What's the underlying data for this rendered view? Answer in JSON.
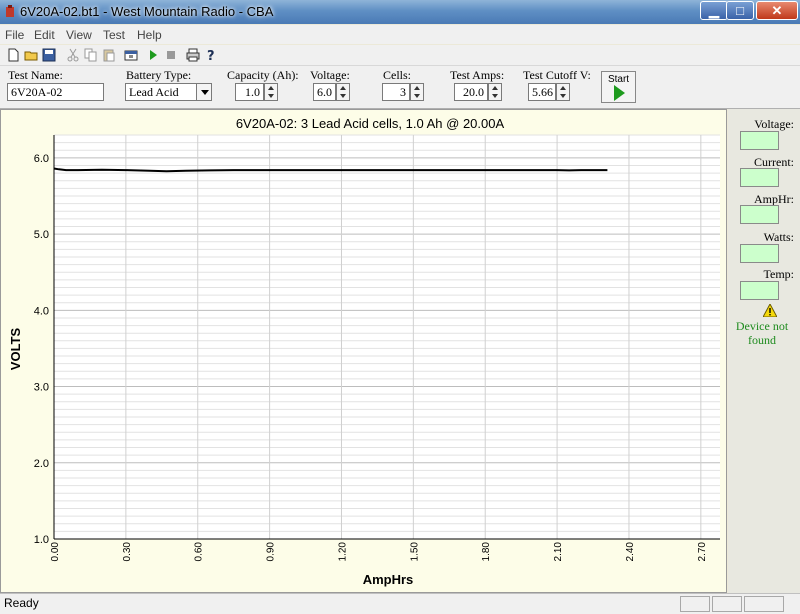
{
  "window": {
    "title": "6V20A-02.bt1 - West Mountain Radio - CBA"
  },
  "menu": [
    "File",
    "Edit",
    "View",
    "Test",
    "Help"
  ],
  "toolbar_icons": [
    "new-file-icon",
    "open-folder-icon",
    "save-icon",
    "cut-icon",
    "copy-icon",
    "paste-icon",
    "settings-icon",
    "run-icon",
    "stop-icon",
    "print-icon",
    "help-icon"
  ],
  "params": {
    "test_name_label": "Test Name:",
    "test_name_value": "6V20A-02",
    "battery_type_label": "Battery Type:",
    "battery_type_value": "Lead Acid",
    "capacity_label": "Capacity (Ah):",
    "capacity_value": "1.0",
    "voltage_label": "Voltage:",
    "voltage_value": "6.0",
    "cells_label": "Cells:",
    "cells_value": "3",
    "test_amps_label": "Test Amps:",
    "test_amps_value": "20.0",
    "cutoff_label": "Test Cutoff V:",
    "cutoff_value": "5.66",
    "start_label": "Start"
  },
  "side": {
    "voltage_label": "Voltage:",
    "current_label": "Current:",
    "amphr_label": "AmpHr:",
    "watts_label": "Watts:",
    "temp_label": "Temp:",
    "device_status": "Device not found",
    "readout_color": "#ccffcc"
  },
  "status": {
    "text": "Ready"
  },
  "colors": {
    "plot_background": "#fdfde8",
    "line": "#000000",
    "status_green": "#1e8b1e"
  },
  "chart_data": {
    "type": "line",
    "title": "6V20A-02: 3 Lead Acid cells, 1.0 Ah @ 20.00A",
    "xlabel": "AmpHrs",
    "ylabel": "VOLTS",
    "xlim": [
      0,
      2.78
    ],
    "ylim": [
      1.0,
      6.3
    ],
    "xticks": [
      "0.00",
      "0.30",
      "0.60",
      "0.90",
      "1.20",
      "1.50",
      "1.80",
      "2.10",
      "2.40",
      "2.70"
    ],
    "yticks": [
      "1.0",
      "2.0",
      "3.0",
      "4.0",
      "5.0",
      "6.0"
    ],
    "grid": true,
    "series": [
      {
        "x": [
          0.0,
          0.02,
          0.05,
          0.1,
          0.2,
          0.3,
          0.4,
          0.47,
          0.55,
          0.65,
          0.75,
          0.9,
          1.2,
          1.5,
          1.8,
          2.1,
          2.15,
          2.2,
          2.31
        ],
        "y": [
          5.86,
          5.85,
          5.84,
          5.84,
          5.845,
          5.84,
          5.83,
          5.825,
          5.83,
          5.835,
          5.84,
          5.84,
          5.84,
          5.84,
          5.84,
          5.84,
          5.835,
          5.84,
          5.84
        ]
      }
    ]
  }
}
